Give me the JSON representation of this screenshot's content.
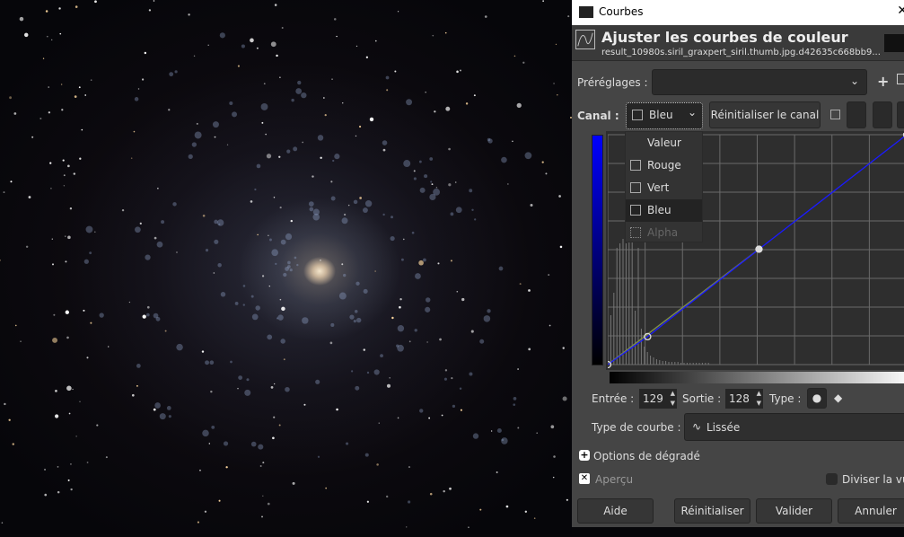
{
  "dialog": {
    "title": "Courbes",
    "heading": "Ajuster les courbes de couleur",
    "subtitle": "result_10980s.siril_graxpert_siril.thumb.jpg.d42635c668bb9...",
    "close_icon": "close-icon"
  },
  "presets": {
    "label": "Préréglages :",
    "value": ""
  },
  "channel": {
    "label": "Canal :",
    "selected": "Bleu",
    "reset_label": "Réinitialiser le canal",
    "options": [
      "Valeur",
      "Rouge",
      "Vert",
      "Bleu",
      "Alpha"
    ]
  },
  "curve": {
    "points": [
      [
        0,
        0
      ],
      [
        34,
        31
      ],
      [
        129,
        128
      ],
      [
        255,
        255
      ]
    ],
    "range": [
      0,
      255
    ],
    "color": "#1a1aff",
    "reference_color": "#7a8a4a"
  },
  "point": {
    "input_label": "Entrée :",
    "input": "129",
    "output_label": "Sortie :",
    "output": "128",
    "type_label": "Type :"
  },
  "curve_type": {
    "label": "Type de courbe :",
    "value": "Lissée"
  },
  "options": {
    "gradient": "Options de dégradé",
    "preview": "Aperçu",
    "split": "Diviser la vue"
  },
  "buttons": {
    "help": "Aide",
    "reset": "Réinitialiser",
    "ok": "Valider",
    "cancel": "Annuler"
  }
}
